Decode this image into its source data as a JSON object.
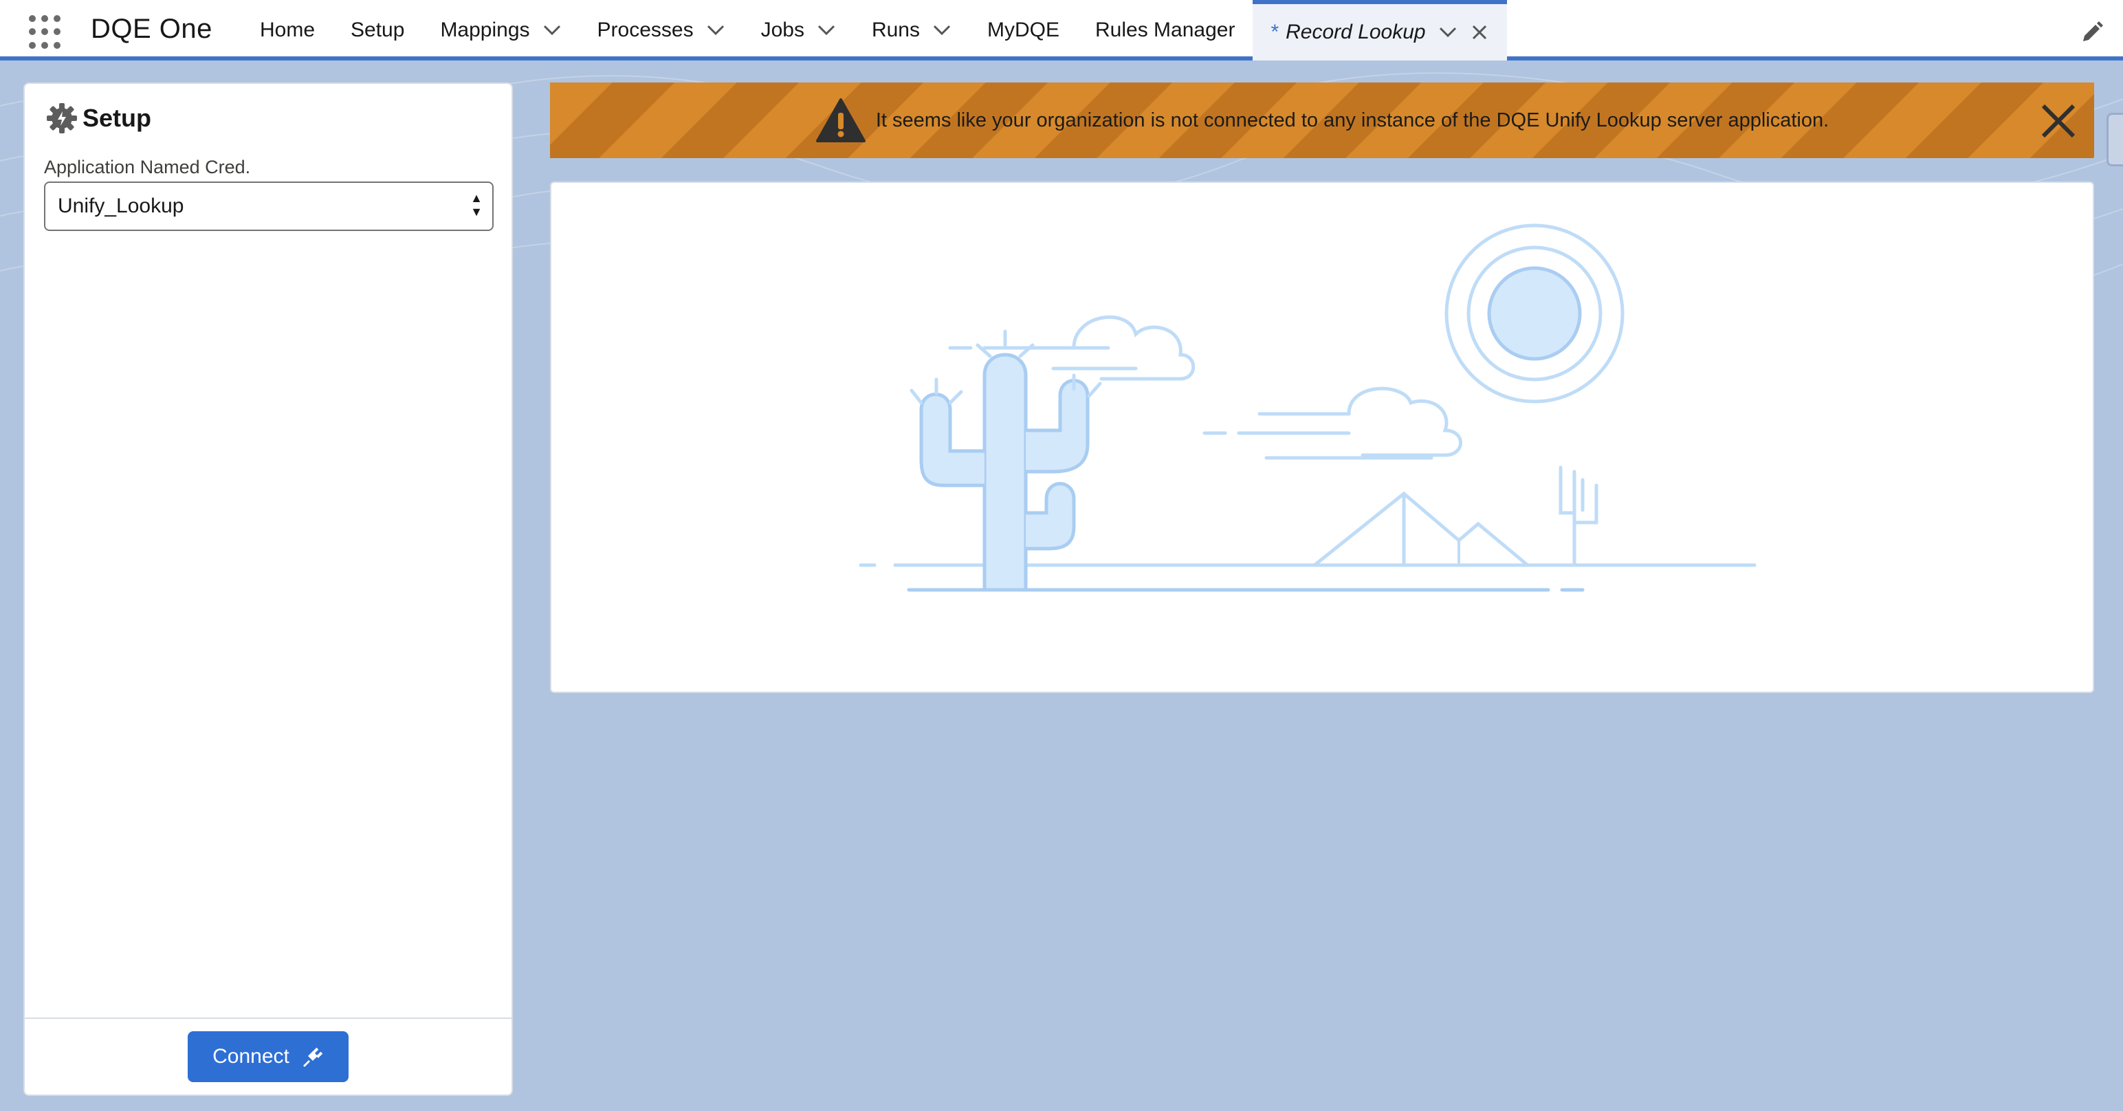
{
  "app": {
    "name": "DQE One",
    "launcher_icon": "app-launcher-waffle-icon"
  },
  "nav": {
    "items": [
      {
        "label": "Home",
        "has_menu": false
      },
      {
        "label": "Setup",
        "has_menu": false
      },
      {
        "label": "Mappings",
        "has_menu": true
      },
      {
        "label": "Processes",
        "has_menu": true
      },
      {
        "label": "Jobs",
        "has_menu": true
      },
      {
        "label": "Runs",
        "has_menu": true
      },
      {
        "label": "MyDQE",
        "has_menu": false
      },
      {
        "label": "Rules Manager",
        "has_menu": false
      }
    ],
    "active_tab": {
      "marker": "*",
      "label": "Record Lookup"
    },
    "edit_icon": "pencil-icon"
  },
  "setup_panel": {
    "title": "Setup",
    "field_label": "Application Named Cred.",
    "selected_value": "Unify_Lookup",
    "connect_label": "Connect"
  },
  "banner": {
    "message": "It seems like your organization is not connected to any instance of the DQE Unify Lookup server application.",
    "icon": "warning-icon"
  },
  "colors": {
    "brand": "#3f73c8",
    "banner": "#c77c22",
    "button": "#2e6fd4",
    "page_bg": "#b0c4df",
    "illustration": "#bfdcf7"
  }
}
